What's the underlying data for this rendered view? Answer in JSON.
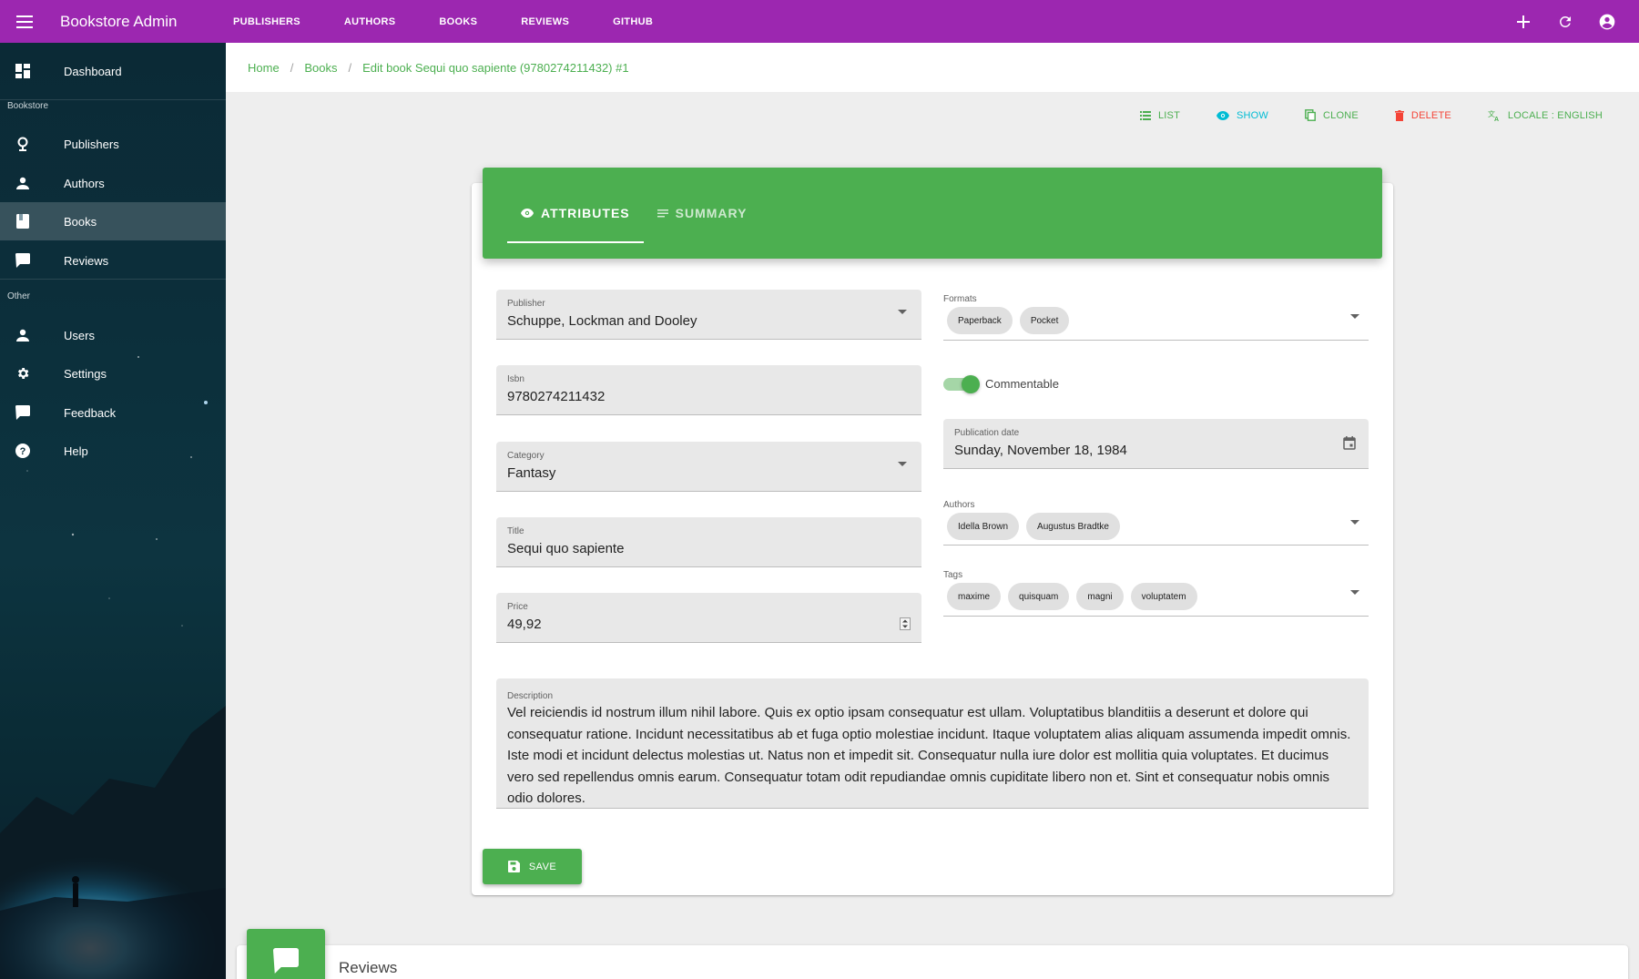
{
  "appbar": {
    "title": "Bookstore Admin",
    "nav": [
      "PUBLISHERS",
      "AUTHORS",
      "BOOKS",
      "REVIEWS",
      "GITHUB"
    ],
    "color": "#9c27b0"
  },
  "sidebar": {
    "dashboard": "Dashboard",
    "section_bookstore": "Bookstore",
    "publishers": "Publishers",
    "authors": "Authors",
    "books": "Books",
    "reviews": "Reviews",
    "section_other": "Other",
    "users": "Users",
    "settings": "Settings",
    "feedback": "Feedback",
    "help": "Help"
  },
  "breadcrumb": {
    "home": "Home",
    "books": "Books",
    "current": "Edit book Sequi quo sapiente (9780274211432) #1"
  },
  "actions": {
    "list": "LIST",
    "show": "SHOW",
    "clone": "CLONE",
    "delete": "DELETE",
    "locale": "LOCALE : ENGLISH"
  },
  "tabs": {
    "attributes": "ATTRIBUTES",
    "summary": "SUMMARY"
  },
  "form": {
    "publisher": {
      "label": "Publisher",
      "value": "Schuppe, Lockman and Dooley"
    },
    "isbn": {
      "label": "Isbn",
      "value": "9780274211432"
    },
    "category": {
      "label": "Category",
      "value": "Fantasy"
    },
    "title": {
      "label": "Title",
      "value": "Sequi quo sapiente"
    },
    "price": {
      "label": "Price",
      "value": "49,92"
    },
    "formats": {
      "label": "Formats",
      "chips": [
        "Paperback",
        "Pocket"
      ]
    },
    "commentable": {
      "label": "Commentable",
      "checked": true
    },
    "publication_date": {
      "label": "Publication date",
      "value": "Sunday, November 18, 1984"
    },
    "authors": {
      "label": "Authors",
      "chips": [
        "Idella Brown",
        "Augustus Bradtke"
      ]
    },
    "tags": {
      "label": "Tags",
      "chips": [
        "maxime",
        "quisquam",
        "magni",
        "voluptatem"
      ]
    },
    "description": {
      "label": "Description",
      "value": "Vel reiciendis id nostrum illum nihil labore. Quis ex optio ipsam consequatur est ullam. Voluptatibus blanditiis a deserunt et dolore qui consequatur ratione. Incidunt necessitatibus ab et fuga optio molestiae incidunt. Itaque voluptatem alias aliquam assumenda impedit omnis. Iste modi et incidunt delectus molestias ut. Natus non et impedit sit. Consequatur nulla iure dolor est mollitia quia voluptates. Et ducimus vero sed repellendus omnis earum. Consequatur totam odit repudiandae omnis cupiditate libero non et. Sint et consequatur nobis omnis odio dolores."
    },
    "save": "SAVE"
  },
  "reviews_panel": {
    "title": "Reviews"
  },
  "colors": {
    "primary": "#4caf50",
    "appbar": "#9c27b0",
    "show": "#00bcd4",
    "delete": "#f44336"
  }
}
